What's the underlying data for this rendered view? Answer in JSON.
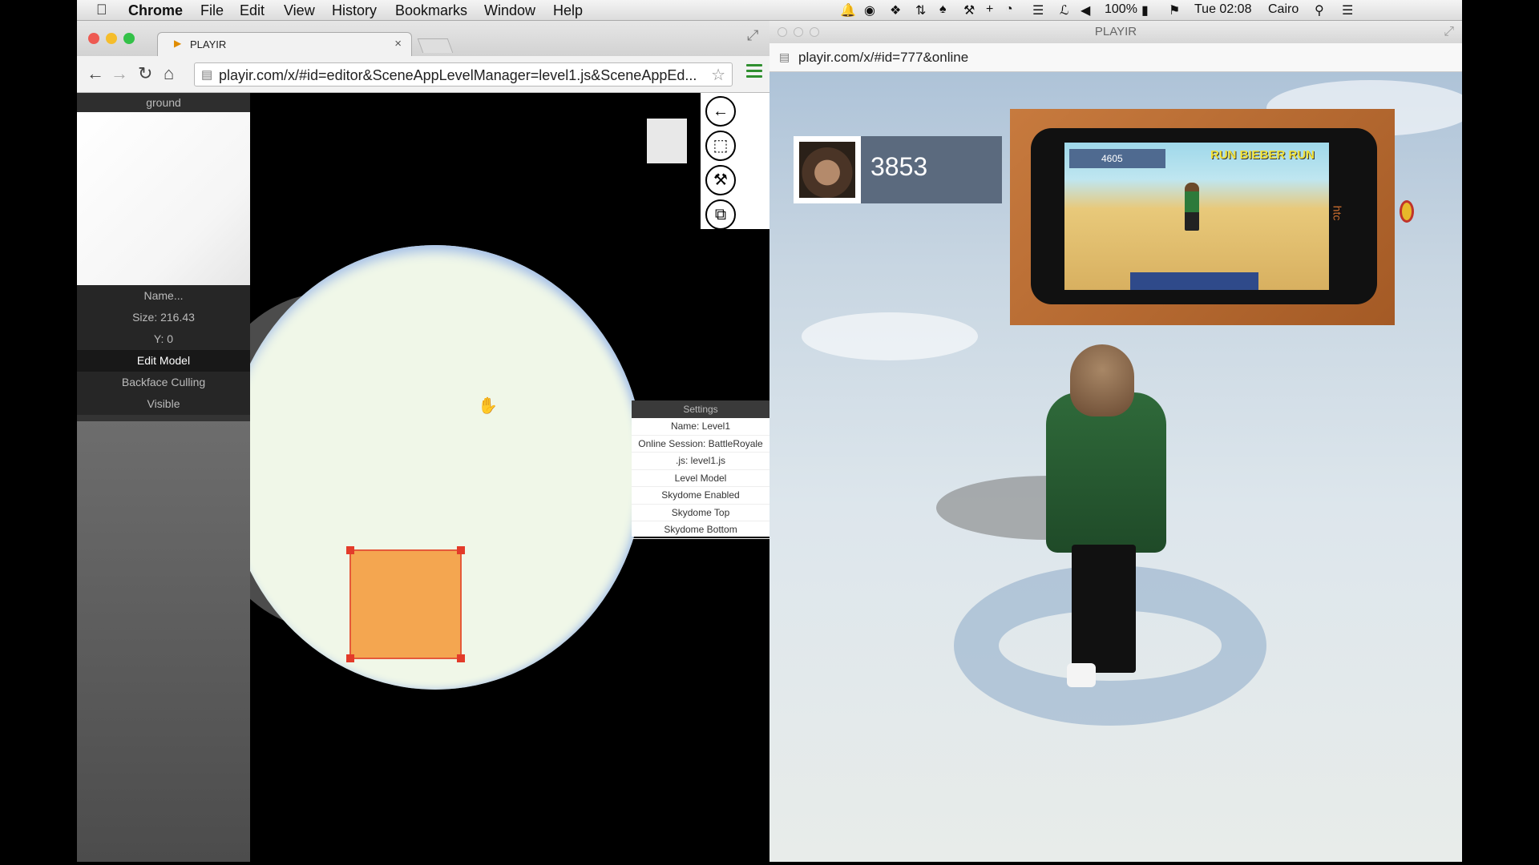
{
  "menubar": {
    "app": "Chrome",
    "items": [
      "File",
      "Edit",
      "View",
      "History",
      "Bookmarks",
      "Window",
      "Help"
    ],
    "battery": "100%",
    "clock": "Tue 02:08",
    "user": "Cairo"
  },
  "editor_window": {
    "tab_title": "PLAYIR",
    "url": "playir.com/x/#id=editor&SceneAppLevelManager=level1.js&SceneAppEd...",
    "left_panel": {
      "title": "ground",
      "rows": [
        "Name...",
        "Size: 216.43",
        "Y: 0",
        "Edit Model",
        "Backface Culling",
        "Visible"
      ]
    },
    "tools": [
      "back-arrow-icon",
      "select-icon",
      "hammer-icon",
      "copy-icon"
    ],
    "settings": {
      "header": "Settings",
      "items": [
        "Name: Level1",
        "Online Session: BattleRoyale",
        ".js: level1.js",
        "Level Model",
        "Skydome Enabled",
        "Skydome Top",
        "Skydome Bottom"
      ]
    }
  },
  "game_window": {
    "title": "PLAYIR",
    "url": "playir.com/x/#id=777&online",
    "score": "3853",
    "phone_score": "4605",
    "phone_game_title": "RUN BIEBER RUN",
    "phone_brand": "htc"
  },
  "colors": {
    "ground": "#f0f7e8",
    "selection_fill": "#f4a650",
    "selection_border": "#e55a3a",
    "jacket": "#2f6a3a"
  }
}
